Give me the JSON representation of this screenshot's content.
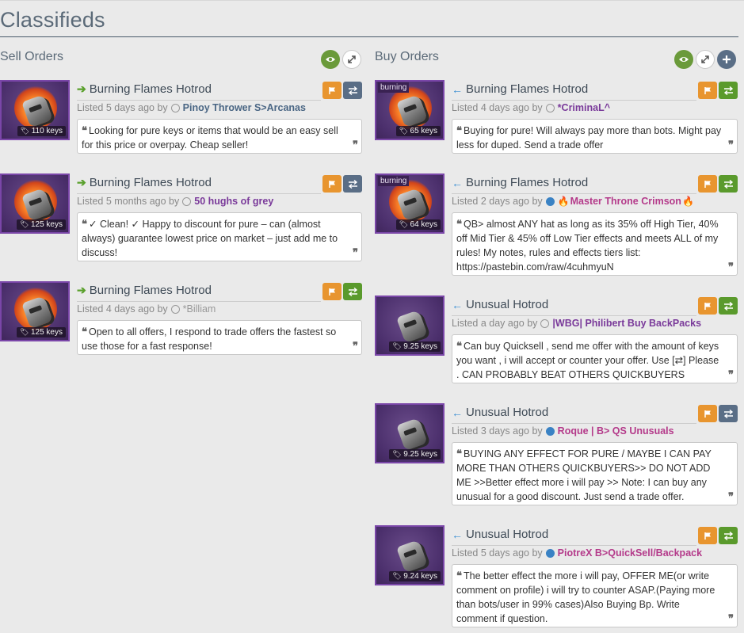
{
  "page": {
    "title": "Classifieds"
  },
  "sell": {
    "title": "Sell Orders",
    "listings": [
      {
        "name": "Burning Flames Hotrod",
        "price": "110 keys",
        "effect": "",
        "listed": "Listed 5 days ago by",
        "status": "offline",
        "user": "Pinoy Thrower S>Arcanas",
        "user_color": "blue",
        "trade_btn": "blue",
        "comment": "Looking for pure keys or items that would be an easy sell for this price or overpay. Cheap seller!"
      },
      {
        "name": "Burning Flames Hotrod",
        "price": "125 keys",
        "effect": "",
        "listed": "Listed 5 months ago by",
        "status": "offline",
        "user": "50 hughs of grey",
        "user_color": "purple",
        "trade_btn": "blue",
        "comment": "✓ Clean! ✓ Happy to discount for pure – can (almost always) guarantee lowest price on market – just add me to discuss!"
      },
      {
        "name": "Burning Flames Hotrod",
        "price": "125 keys",
        "effect": "",
        "listed": "Listed 4 days ago by",
        "status": "offline",
        "user": "*Billiam",
        "user_color": "grey",
        "trade_btn": "green",
        "comment": "Open to all offers, I respond to trade offers the fastest so use those for a fast response!"
      }
    ]
  },
  "buy": {
    "title": "Buy Orders",
    "listings": [
      {
        "name": "Burning Flames Hotrod",
        "price": "65 keys",
        "effect": "burning",
        "listed": "Listed 4 days ago by",
        "status": "offline",
        "user": "*CriminaL^",
        "user_color": "purple",
        "trade_btn": "green",
        "comment": "Buying for pure! Will always pay more than bots. Might pay less for duped. Send a trade offer"
      },
      {
        "name": "Burning Flames Hotrod",
        "price": "64 keys",
        "effect": "burning",
        "listed": "Listed 2 days ago by",
        "status": "online",
        "user": "Master Throne Crimson",
        "user_color": "magenta",
        "trade_btn": "green",
        "comment": "QB> almost ANY hat as long as its 35% off High Tier, 40% off Mid Tier & 45% off Low Tier effects and meets ALL of my rules! My notes, rules and effects tiers list: https://pastebin.com/raw/4cuhmyuN"
      },
      {
        "name": "Unusual Hotrod",
        "price": "9.25 keys",
        "effect": "",
        "listed": "Listed a day ago by",
        "status": "offline",
        "user": "|WBG| Philibert Buy BackPacks",
        "user_color": "purple",
        "trade_btn": "green",
        "comment": "Can buy Quicksell , send me offer with the amount of keys you want , i will accept or counter your offer. Use [⇄] Please . CAN PROBABLY BEAT OTHERS QUICKBUYERS"
      },
      {
        "name": "Unusual Hotrod",
        "price": "9.25 keys",
        "effect": "",
        "listed": "Listed 3 days ago by",
        "status": "online",
        "user": "Roque | B> QS Unusuals",
        "user_color": "magenta",
        "trade_btn": "blue",
        "comment": "BUYING ANY EFFECT FOR PURE / MAYBE I CAN PAY MORE THAN OTHERS QUICKBUYERS>> DO NOT ADD ME >>Better effect more i will pay >> Note: I can buy any unusual for a good discount. Just send a trade offer."
      },
      {
        "name": "Unusual Hotrod",
        "price": "9.24 keys",
        "effect": "",
        "listed": "Listed 5 days ago by",
        "status": "online",
        "user": "PiotreX B>QuickSell/Backpack",
        "user_color": "magenta",
        "trade_btn": "green",
        "comment": "The better effect the more i will pay, OFFER ME(or write comment on profile) i will try to counter ASAP.(Paying more than bots/user in 99% cases)Also Buying Bp. Write comment if question."
      }
    ]
  },
  "colors": {
    "accent_title": "#5b6a78",
    "flag_btn": "#e8952f",
    "trade_green": "#5a9a2c",
    "trade_blue": "#5a6e86",
    "item_border": "#7a46a8"
  }
}
